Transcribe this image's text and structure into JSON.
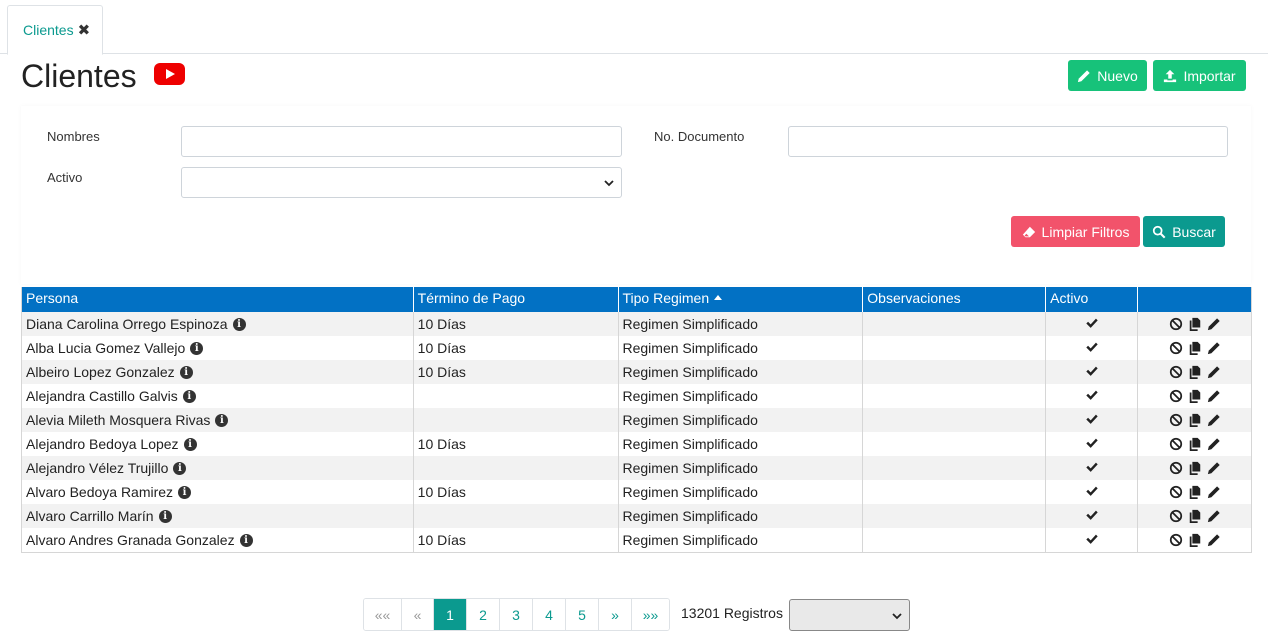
{
  "tab": {
    "label": "Clientes",
    "close": "✖"
  },
  "header": {
    "title": "Clientes",
    "nuevo_label": "Nuevo",
    "importar_label": "Importar"
  },
  "filters": {
    "nombres_label": "Nombres",
    "nombres_value": "",
    "documento_label": "No. Documento",
    "documento_value": "",
    "activo_label": "Activo",
    "activo_value": "",
    "limpiar_label": "Limpiar Filtros",
    "buscar_label": "Buscar"
  },
  "table": {
    "columns": [
      "Persona",
      "Término de Pago",
      "Tipo Regimen",
      "Observaciones",
      "Activo",
      ""
    ],
    "sorted_column": "Tipo Regimen",
    "rows": [
      {
        "persona": "Diana Carolina Orrego Espinoza",
        "termino": "10 Días",
        "regimen": "Regimen Simplificado",
        "observaciones": ""
      },
      {
        "persona": "Alba Lucia Gomez Vallejo",
        "termino": "10 Días",
        "regimen": "Regimen Simplificado",
        "observaciones": ""
      },
      {
        "persona": "Albeiro Lopez Gonzalez",
        "termino": "10 Días",
        "regimen": "Regimen Simplificado",
        "observaciones": ""
      },
      {
        "persona": "Alejandra Castillo Galvis",
        "termino": "",
        "regimen": "Regimen Simplificado",
        "observaciones": ""
      },
      {
        "persona": "Alevia Mileth Mosquera Rivas",
        "termino": "",
        "regimen": "Regimen Simplificado",
        "observaciones": ""
      },
      {
        "persona": "Alejandro Bedoya Lopez",
        "termino": "10 Días",
        "regimen": "Regimen Simplificado",
        "observaciones": ""
      },
      {
        "persona": "Alejandro Vélez Trujillo",
        "termino": "",
        "regimen": "Regimen Simplificado",
        "observaciones": ""
      },
      {
        "persona": "Alvaro Bedoya Ramirez",
        "termino": "10 Días",
        "regimen": "Regimen Simplificado",
        "observaciones": ""
      },
      {
        "persona": "Alvaro Carrillo Marín",
        "termino": "",
        "regimen": "Regimen Simplificado",
        "observaciones": ""
      },
      {
        "persona": "Alvaro Andres Granada Gonzalez",
        "termino": "10 Días",
        "regimen": "Regimen Simplificado",
        "observaciones": ""
      }
    ]
  },
  "pagination": {
    "first": "«« ",
    "prev": "«",
    "pages": [
      "1",
      "2",
      "3",
      "4",
      "5"
    ],
    "current": "1",
    "next": "»",
    "last": "»»",
    "registros": "13201 Registros",
    "page_size_value": ""
  },
  "colors": {
    "primary": "#0b9a8f",
    "success": "#17c27a",
    "danger": "#f2536b",
    "header_blue": "#0271c4",
    "youtube": "#ee0000"
  },
  "icons": [
    "close-icon",
    "youtube-icon",
    "pencil-icon",
    "upload-icon",
    "eraser-icon",
    "search-icon",
    "info-icon",
    "check-icon",
    "ban-icon",
    "copy-icon",
    "edit-icon",
    "chevron-down-icon"
  ]
}
